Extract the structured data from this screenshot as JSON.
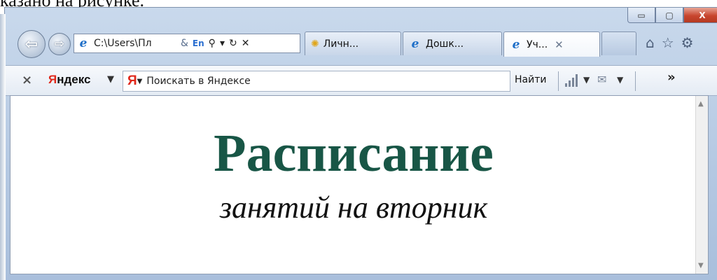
{
  "caption": "казано на рисунке.",
  "window": {
    "min_label": "▭",
    "max_label": "▢",
    "close_label": "X"
  },
  "nav": {
    "address": "C:\\Users\\Пл",
    "lang_label": "En",
    "tabs": [
      {
        "label": "Личн...",
        "icon": "browser-icon"
      },
      {
        "label": "Дошк...",
        "icon": "ie-icon"
      },
      {
        "label": "Уч...",
        "icon": "ie-icon",
        "active": true
      }
    ],
    "right_icons": [
      "home-icon",
      "favorites-star-icon",
      "settings-gear-icon"
    ]
  },
  "toolbar": {
    "close_label": "×",
    "brand_first": "Я",
    "brand_rest": "ндекс",
    "logo": "Я",
    "search_placeholder": "Поискать в Яндексе",
    "find_label": "Найти",
    "more_label": "»"
  },
  "page": {
    "title": "Расписание",
    "subtitle": "занятий на вторник",
    "title_color": "#185646"
  }
}
